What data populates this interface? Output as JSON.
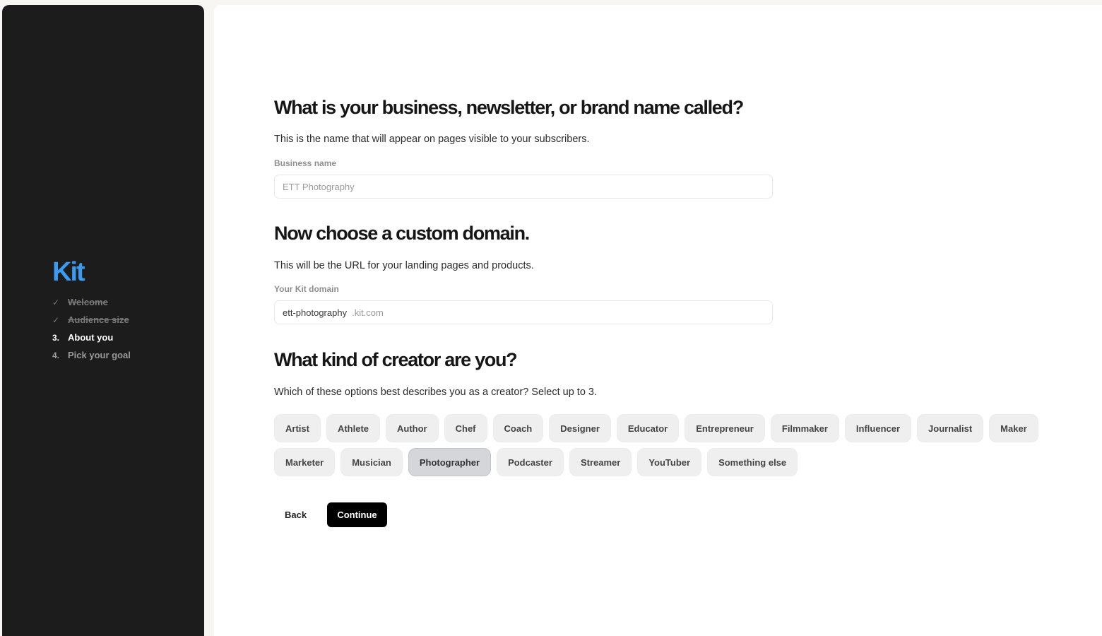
{
  "sidebar": {
    "logo_text": "Kit",
    "steps": [
      {
        "marker": "✓",
        "label": "Welcome",
        "state": "done"
      },
      {
        "marker": "✓",
        "label": "Audience size",
        "state": "done"
      },
      {
        "marker": "3.",
        "label": "About you",
        "state": "current"
      },
      {
        "marker": "4.",
        "label": "Pick your goal",
        "state": "upcoming"
      }
    ]
  },
  "business": {
    "heading": "What is your business, newsletter, or brand name called?",
    "description": "This is the name that will appear on pages visible to your subscribers.",
    "field_label": "Business name",
    "placeholder": "ETT Photography"
  },
  "domain": {
    "heading": "Now choose a custom domain.",
    "description": "This will be the URL for your landing pages and products.",
    "field_label": "Your Kit domain",
    "value": "ett-photography",
    "suffix": ".kit.com"
  },
  "creator": {
    "heading": "What kind of creator are you?",
    "description": "Which of these options best describes you as a creator? Select up to 3.",
    "options_row1": [
      "Artist",
      "Athlete",
      "Author",
      "Chef",
      "Coach",
      "Designer",
      "Educator",
      "Entrepreneur",
      "Filmmaker",
      "Influencer",
      "Journalist",
      "Maker"
    ],
    "options_row2": [
      "Marketer",
      "Musician",
      "Photographer",
      "Podcaster",
      "Streamer",
      "YouTuber",
      "Something else"
    ],
    "selected": [
      "Photographer"
    ]
  },
  "actions": {
    "back_label": "Back",
    "continue_label": "Continue"
  },
  "colors": {
    "sidebar_bg": "#1c1c1c",
    "logo": "#3b9bf0",
    "primary_button": "#000000",
    "chip_bg": "#efefef",
    "chip_selected_bg": "#d4d6d9"
  }
}
